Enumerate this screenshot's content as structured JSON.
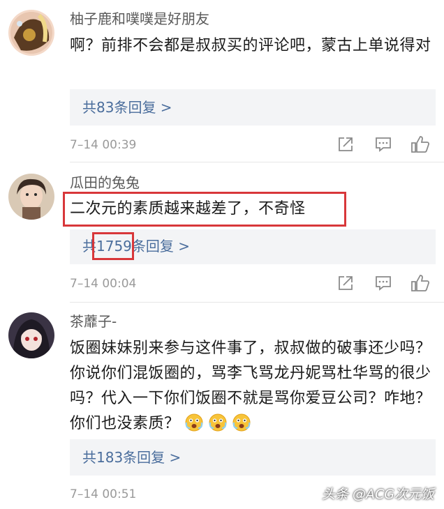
{
  "comments": [
    {
      "username": "柚子鹿和噗噗是好朋友",
      "text": "啊？前排不会都是叔叔买的评论吧，蒙古上单说得对",
      "reply_link": "共83条回复 >",
      "timestamp": "7–14 00:39"
    },
    {
      "username": "瓜田的兔兔",
      "text": "二次元的素质越来越差了，不奇怪",
      "reply_prefix": "共",
      "reply_count": "1759",
      "reply_suffix": "条回复 >",
      "timestamp": "7–14 00:04"
    },
    {
      "username": "茶蘼子-",
      "text": "饭圈妹妹别来参与这件事了，叔叔做的破事还少吗？你说你们混饭圈的，骂李飞骂龙丹妮骂杜华骂的很少吗？代入一下你们饭圈不就是骂你爱豆公司？咋地？你们也没素质？",
      "reply_link": "共183条回复 >",
      "timestamp": "7–14 00:51"
    }
  ],
  "icons": {
    "share": "share-icon",
    "comment": "comment-icon",
    "like": "thumbs-up-icon",
    "emoji": "scared-face-emoji"
  },
  "watermark": "头条 @ACG次元饭",
  "colors": {
    "link": "#4a6d9c",
    "highlight": "#d8373a"
  }
}
